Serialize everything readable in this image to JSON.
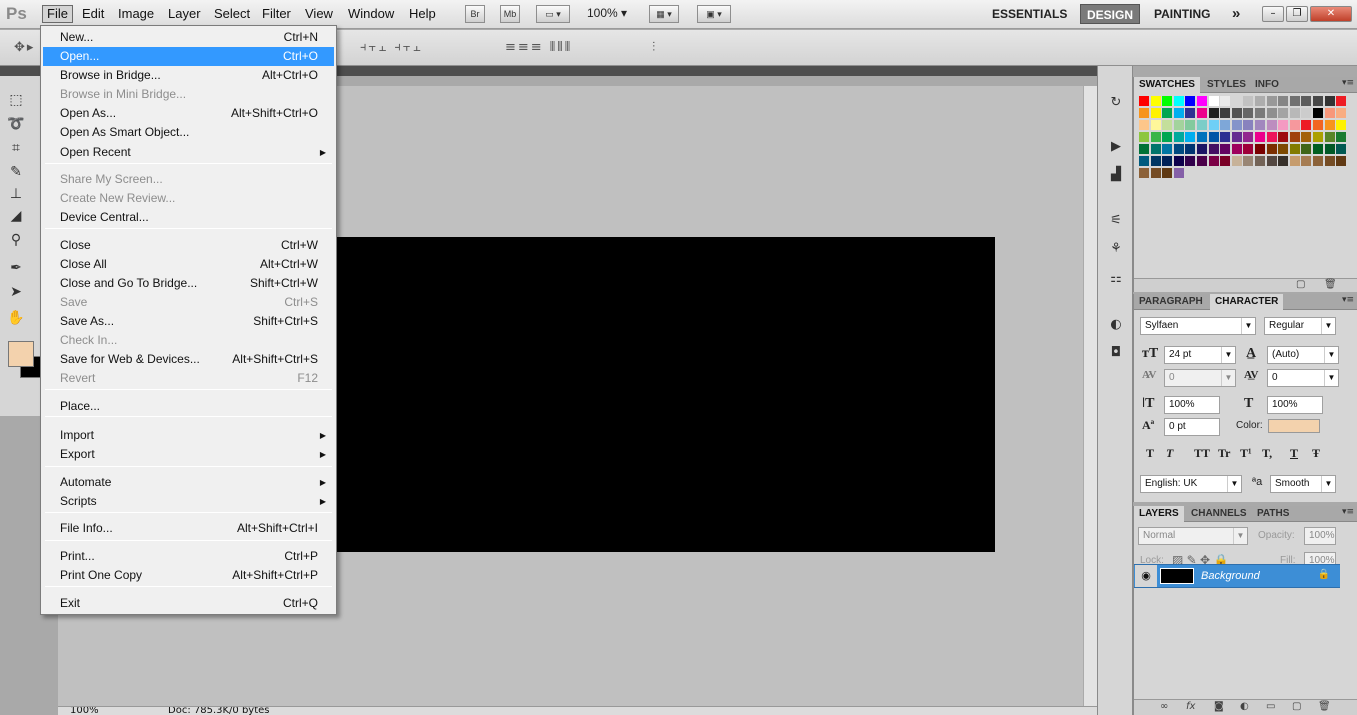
{
  "app": {
    "logo": "Ps"
  },
  "menubar": {
    "items": [
      "File",
      "Edit",
      "Image",
      "Layer",
      "Select",
      "Filter",
      "View",
      "Window",
      "Help"
    ],
    "bridge_btn": "Br",
    "minibridge_btn": "Mb",
    "zoom": "100%",
    "workspaces": [
      "ESSENTIALS",
      "DESIGN",
      "PAINTING"
    ],
    "more": "»"
  },
  "file_menu": {
    "items": [
      {
        "label": "New...",
        "shortcut": "Ctrl+N"
      },
      {
        "label": "Open...",
        "shortcut": "Ctrl+O",
        "highlighted": true
      },
      {
        "label": "Browse in Bridge...",
        "shortcut": "Alt+Ctrl+O"
      },
      {
        "label": "Browse in Mini Bridge...",
        "shortcut": "",
        "disabled": true
      },
      {
        "label": "Open As...",
        "shortcut": "Alt+Shift+Ctrl+O"
      },
      {
        "label": "Open As Smart Object...",
        "shortcut": ""
      },
      {
        "label": "Open Recent",
        "shortcut": "",
        "submenu": true
      },
      {
        "label": "Share My Screen...",
        "shortcut": "",
        "disabled": true
      },
      {
        "label": "Create New Review...",
        "shortcut": "",
        "disabled": true
      },
      {
        "label": "Device Central...",
        "shortcut": ""
      },
      {
        "label": "Close",
        "shortcut": "Ctrl+W"
      },
      {
        "label": "Close All",
        "shortcut": "Alt+Ctrl+W"
      },
      {
        "label": "Close and Go To Bridge...",
        "shortcut": "Shift+Ctrl+W"
      },
      {
        "label": "Save",
        "shortcut": "Ctrl+S",
        "disabled": true
      },
      {
        "label": "Save As...",
        "shortcut": "Shift+Ctrl+S"
      },
      {
        "label": "Check In...",
        "shortcut": "",
        "disabled": true
      },
      {
        "label": "Save for Web & Devices...",
        "shortcut": "Alt+Shift+Ctrl+S"
      },
      {
        "label": "Revert",
        "shortcut": "F12",
        "disabled": true
      },
      {
        "label": "Place...",
        "shortcut": ""
      },
      {
        "label": "Import",
        "shortcut": "",
        "submenu": true
      },
      {
        "label": "Export",
        "shortcut": "",
        "submenu": true
      },
      {
        "label": "Automate",
        "shortcut": "",
        "submenu": true
      },
      {
        "label": "Scripts",
        "shortcut": "",
        "submenu": true
      },
      {
        "label": "File Info...",
        "shortcut": "Alt+Shift+Ctrl+I"
      },
      {
        "label": "Print...",
        "shortcut": "Ctrl+P"
      },
      {
        "label": "Print One Copy",
        "shortcut": "Alt+Shift+Ctrl+P"
      },
      {
        "label": "Exit",
        "shortcut": "Ctrl+Q"
      }
    ]
  },
  "swatches_panel": {
    "tabs": [
      "SWATCHES",
      "STYLES",
      "INFO"
    ],
    "rows": [
      [
        "#ff0000",
        "#ffff00",
        "#00ff00",
        "#00ffff",
        "#0000ff",
        "#ff00ff",
        "#ffffff",
        "#ebebeb",
        "#d6d6d6",
        "#c2c2c2",
        "#adadad",
        "#999999",
        "#858585",
        "#707070",
        "#5c5c5c",
        "#474747",
        "#333333",
        "#ee1c24"
      ],
      [
        "#f7941d",
        "#fff200",
        "#00a651",
        "#00aeef",
        "#2e3192",
        "#ec008c",
        "#1f1f1f",
        "#3d3d3d",
        "#525252",
        "#666666",
        "#7a7a7a",
        "#8f8f8f",
        "#a3a3a3",
        "#b8b8b8",
        "#cccccc",
        "#000000",
        "#f7977a",
        "#f9ad81"
      ],
      [
        "#fdc68a",
        "#fff79a",
        "#c4df9b",
        "#a3d39c",
        "#82ca9d",
        "#7bcdc8",
        "#6ecff6",
        "#7ea7d8",
        "#8493ca",
        "#8882be",
        "#a187be",
        "#bc8dbf",
        "#f49ac2",
        "#f6989d",
        "#ed1c24",
        "#f26522",
        "#f7941d",
        "#fff200"
      ],
      [
        "#8dc63f",
        "#39b54a",
        "#00a651",
        "#00a99d",
        "#00aeef",
        "#0072bc",
        "#0054a6",
        "#2e3192",
        "#662d91",
        "#92278f",
        "#ec008c",
        "#ed145b",
        "#9e0b0f",
        "#a0410d",
        "#a36209",
        "#aba000",
        "#598527",
        "#197b30"
      ],
      [
        "#007236",
        "#00746b",
        "#0076a3",
        "#004a80",
        "#003471",
        "#1b1464",
        "#440e62",
        "#630460",
        "#9e005d",
        "#9e0039",
        "#790000",
        "#7b2e00",
        "#7d4900",
        "#827b00",
        "#406618",
        "#005e20",
        "#005826",
        "#005952"
      ],
      [
        "#005b7f",
        "#003663",
        "#002157",
        "#0d004c",
        "#32004b",
        "#4b0049",
        "#7b0046",
        "#7a0026",
        "#c7b299",
        "#998675",
        "#736357",
        "#534741",
        "#37302a",
        "#c69c6d",
        "#a67c52",
        "#8c6239",
        "#754c24",
        "#603913"
      ],
      [
        "#8c6239",
        "#754c24",
        "#603913",
        "#8560a8"
      ]
    ]
  },
  "character_panel": {
    "tabs": [
      "PARAGRAPH",
      "CHARACTER"
    ],
    "font_family": "Sylfaen",
    "font_style": "Regular",
    "size": "24 pt",
    "leading": "(Auto)",
    "kerning": "0",
    "tracking": "0",
    "vscale": "100%",
    "hscale": "100%",
    "baseline": "0 pt",
    "color_label": "Color:",
    "color": "#f3d2ad",
    "styles": [
      "T",
      "T",
      "TT",
      "Tr",
      "T¹",
      "T,",
      "T",
      "Ŧ"
    ],
    "language": "English: UK",
    "antialias_icon": "ªa",
    "antialias": "Smooth"
  },
  "layers_panel": {
    "tabs": [
      "LAYERS",
      "CHANNELS",
      "PATHS"
    ],
    "blend_mode": "Normal",
    "opacity_label": "Opacity:",
    "opacity": "100%",
    "lock_label": "Lock:",
    "fill_label": "Fill:",
    "fill": "100%",
    "layers": [
      {
        "name": "Background"
      }
    ],
    "footer_icons": [
      "link-icon",
      "fx-icon",
      "mask-icon",
      "adjustment-icon",
      "group-icon",
      "new-layer-icon",
      "trash-icon"
    ]
  },
  "status": {
    "zoom": "100%",
    "doc": "Doc: 785.3K/0 bytes"
  },
  "colors": {
    "foreground": "#f3d2ad",
    "background": "#000000",
    "highlight": "#3399ff"
  }
}
